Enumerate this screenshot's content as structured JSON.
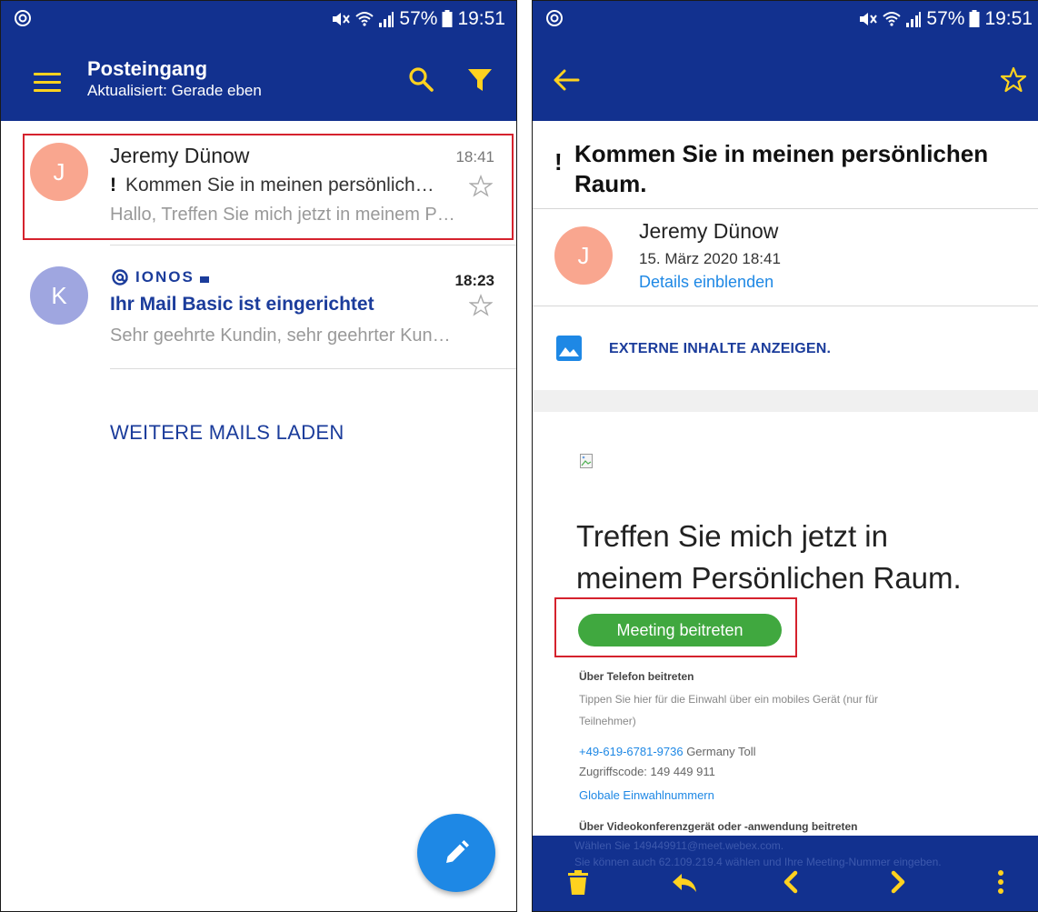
{
  "statusbar": {
    "battery": "57%",
    "time": "19:51"
  },
  "inbox": {
    "title": "Posteingang",
    "subtitle": "Aktualisiert: Gerade eben",
    "emails": [
      {
        "avatar": "J",
        "avatar_color": "#f9a68f",
        "sender": "Jeremy Dünow",
        "time": "18:41",
        "subject": "Kommen Sie in meinen persönlich…",
        "preview": "Hallo, Treffen Sie mich jetzt in meinem P…"
      },
      {
        "avatar": "K",
        "avatar_color": "#9fa6e0",
        "sender_logo": "IONOS",
        "time": "18:23",
        "subject": "Ihr Mail Basic ist eingerichtet",
        "preview": "Sehr geehrte Kundin, sehr geehrter Kun…"
      }
    ],
    "load_more": "WEITERE MAILS LADEN"
  },
  "message": {
    "subject_line1": "Kommen Sie in meinen persönlichen",
    "subject_line2": "Raum.",
    "avatar": "J",
    "sender": "Jeremy Dünow",
    "date": "15. März 2020 18:41",
    "details_link": "Details einblenden",
    "external_content": "EXTERNE INHALTE ANZEIGEN.",
    "headline_line1": "Treffen Sie mich jetzt in",
    "headline_line2": "meinem Persönlichen Raum.",
    "meeting_button": "Meeting beitreten",
    "phone_heading": "Über Telefon beitreten",
    "phone_desc_line1": "Tippen Sie hier für die Einwahl über ein mobiles Gerät (nur für",
    "phone_desc_line2": "Teilnehmer)",
    "phone_number": "+49-619-6781-9736",
    "phone_country": " Germany Toll",
    "access_code": "Zugriffscode: 149 449 911",
    "global_numbers": "Globale Einwahlnummern",
    "video_heading": "Über Videokonferenzgerät oder -anwendung beitreten",
    "faint_line1": "Wählen Sie 149449911@meet.webex.com.",
    "faint_line2": "Sie können auch 62.109.219.4 wählen und Ihre Meeting-Nummer eingeben."
  },
  "colors": {
    "primary": "#12318f",
    "accent": "#ffd21f",
    "fab": "#1e88e5",
    "meeting_button": "#40a83f",
    "highlight": "#d5222d"
  }
}
